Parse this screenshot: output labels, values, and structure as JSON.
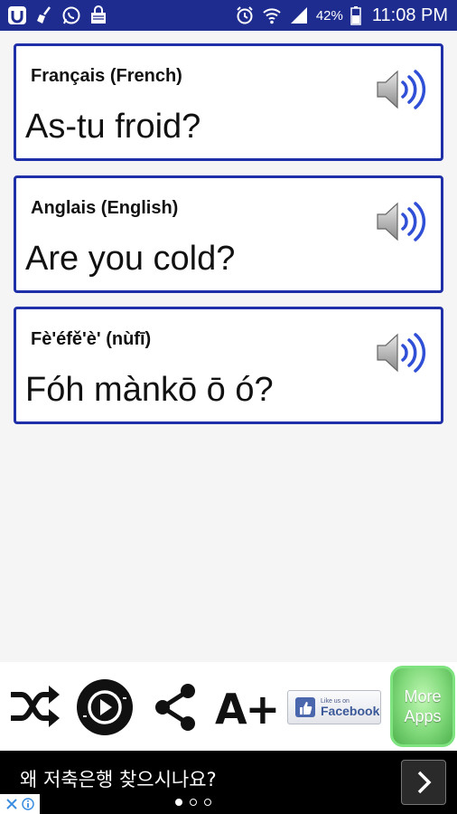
{
  "status_bar": {
    "battery": "42%",
    "time": "11:08 PM",
    "icons": [
      "app-icon",
      "broom-icon",
      "whatsapp-icon",
      "shopping-bag-icon",
      "alarm-icon",
      "wifi-icon",
      "signal-icon",
      "battery-icon"
    ]
  },
  "cards": [
    {
      "language": "Français (French)",
      "phrase": "As-tu froid?"
    },
    {
      "language": "Anglais (English)",
      "phrase": "Are you cold?"
    },
    {
      "language": "Fè'éfě'è' (nùfī)",
      "phrase": "Fóh mànkō ō ó?"
    }
  ],
  "toolbar": {
    "font_button": "A+",
    "facebook_small": "Like us on",
    "facebook_label": "Facebook",
    "more_apps_line1": "More",
    "more_apps_line2": "Apps"
  },
  "ad": {
    "text": "왜 저축은행 찾으시나요?",
    "pages": 3,
    "active_page": 1
  },
  "colors": {
    "status_bar": "#1d2c8e",
    "card_border": "#1f2fa8",
    "speaker_waves": "#2f4fd6",
    "more_apps": "#7fd879"
  }
}
